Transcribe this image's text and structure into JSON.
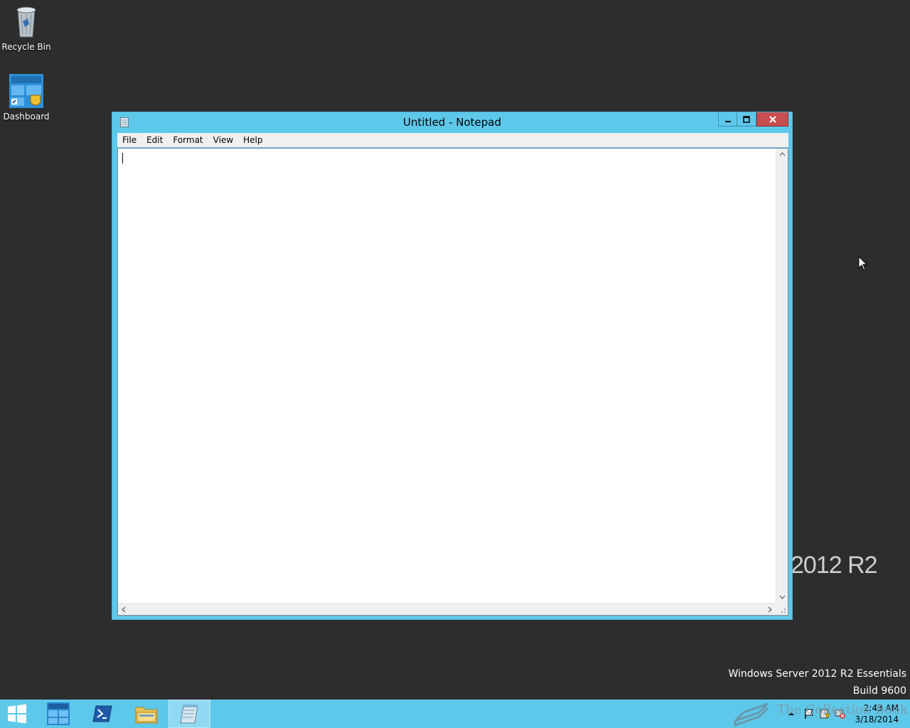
{
  "desktop": {
    "icons": [
      {
        "label": "Recycle Bin",
        "icon": "recycle-bin-icon"
      },
      {
        "label": "Dashboard",
        "icon": "dashboard-icon"
      }
    ],
    "branding_text": "2012 R2",
    "edition_name": "Windows Server 2012 R2 Essentials",
    "edition_build": "Build 9600",
    "watermark_text": "The Collection Book"
  },
  "window": {
    "title": "Untitled - Notepad",
    "menu": [
      "File",
      "Edit",
      "Format",
      "View",
      "Help"
    ],
    "content": "",
    "accent_color": "#5ec8ea",
    "close_color": "#c74f4f"
  },
  "taskbar": {
    "items": [
      "start-icon",
      "server-manager-icon",
      "powershell-icon",
      "file-explorer-icon",
      "notepad-icon"
    ],
    "active": "notepad",
    "clock_time": "2:43 AM",
    "clock_date": "3/18/2014",
    "tray_icons": [
      "show-hidden-icons-icon",
      "action-center-flag-icon",
      "server-status-icon",
      "network-error-icon"
    ]
  }
}
